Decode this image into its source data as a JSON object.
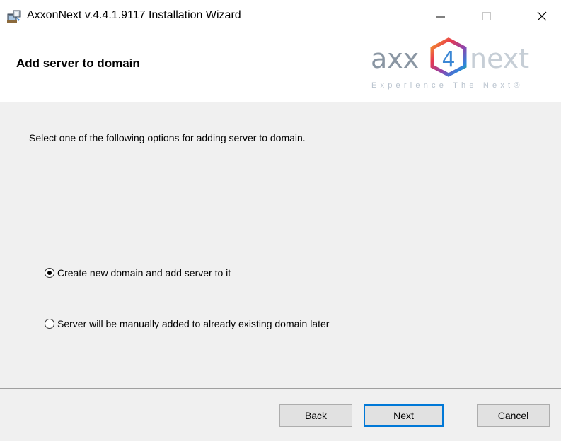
{
  "window": {
    "title": "AxxonNext v.4.4.1.9117 Installation Wizard",
    "icons": {
      "app": "installer-icon",
      "minimize": "minimize-icon",
      "maximize": "maximize-icon",
      "close": "close-icon"
    }
  },
  "banner": {
    "title": "Add server to domain",
    "logo": {
      "left_text": "axx",
      "number": "4",
      "right_text": "next",
      "tagline": "Experience The Next®"
    }
  },
  "content": {
    "instruction": "Select one of the following options for adding server to domain.",
    "options": [
      {
        "label": "Create new domain and add server to it",
        "selected": true
      },
      {
        "label": "Server will be manually added to already existing domain later",
        "selected": false
      }
    ]
  },
  "buttons": {
    "back": "Back",
    "next": "Next",
    "cancel": "Cancel"
  },
  "colors": {
    "accent": "#0078d7",
    "logo_gray": "#b9c3ce",
    "logo_dark": "#8a96a3"
  }
}
